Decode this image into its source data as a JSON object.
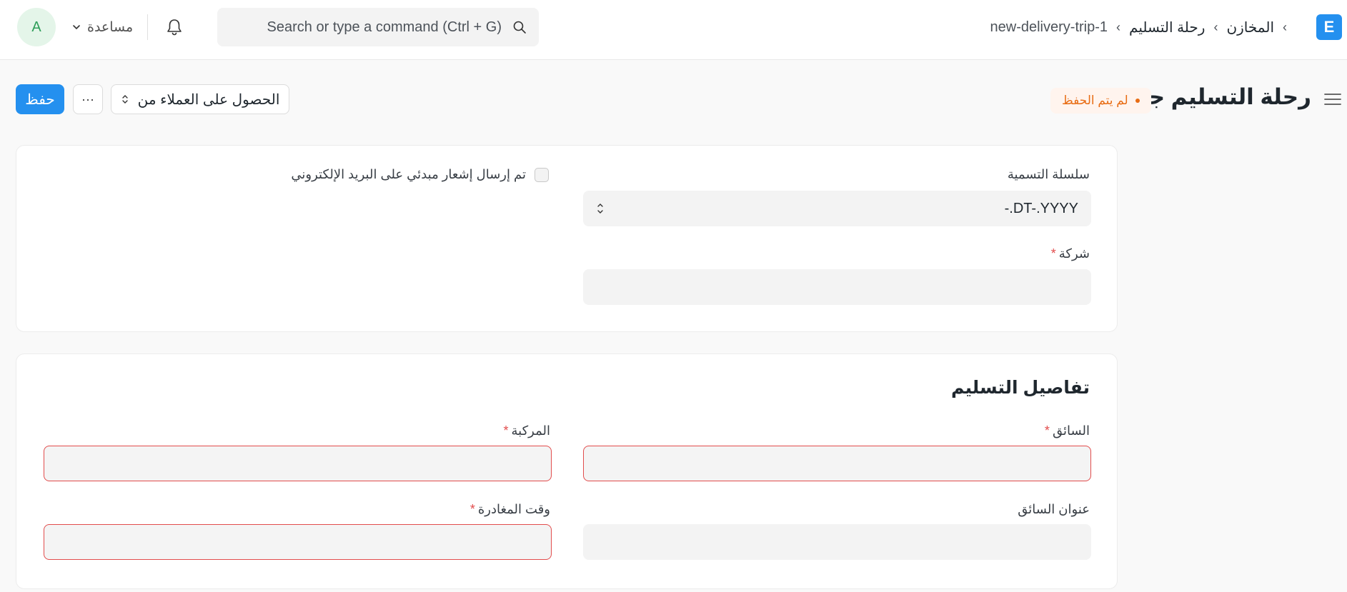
{
  "navbar": {
    "avatar_initial": "A",
    "help_label": "مساعدة",
    "search_placeholder": "Search or type a command (Ctrl + G)",
    "breadcrumb": {
      "module": "المخازن",
      "doctype": "رحلة التسليم",
      "current": "new-delivery-trip-1",
      "separator": "›"
    },
    "logo_letter": "E"
  },
  "page_head": {
    "title": "رحلة التسليم جديد",
    "status": "لم يتم الحفظ",
    "get_customers_label": "الحصول على العملاء من",
    "more_label": "···",
    "save_label": "حفظ"
  },
  "form": {
    "naming_series": {
      "label": "سلسلة التسمية",
      "value": "-.DT-.YYYY"
    },
    "email_notification": {
      "label": "تم إرسال إشعار مبدئي على البريد الإلكتروني",
      "checked": false
    },
    "company": {
      "label": "شركة",
      "required": "*",
      "value": ""
    },
    "delivery_details": {
      "title": "تفاصيل التسليم",
      "driver": {
        "label": "السائق",
        "required": "*",
        "value": ""
      },
      "vehicle": {
        "label": "المركبة",
        "required": "*",
        "value": ""
      },
      "driver_address": {
        "label": "عنوان السائق",
        "value": ""
      },
      "departure_time": {
        "label": "وقت المغادرة",
        "required": "*",
        "value": ""
      }
    }
  },
  "colors": {
    "primary": "#2490ef",
    "status_orange": "#e86c13",
    "error_border": "#e24c4c"
  }
}
